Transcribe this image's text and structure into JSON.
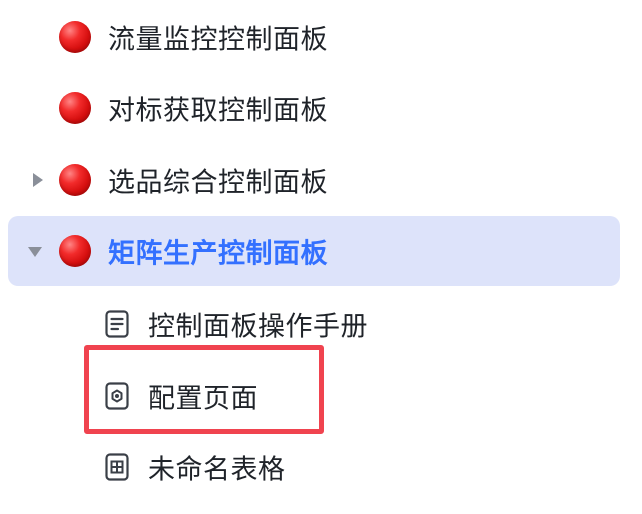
{
  "tree": {
    "items": [
      {
        "label": "流量监控控制面板",
        "icon": "red-circle-icon",
        "expander": "none",
        "selected": false
      },
      {
        "label": "对标获取控制面板",
        "icon": "red-circle-icon",
        "expander": "none",
        "selected": false
      },
      {
        "label": "选品综合控制面板",
        "icon": "red-circle-icon",
        "expander": "collapsed",
        "selected": false
      },
      {
        "label": "矩阵生产控制面板",
        "icon": "red-circle-icon",
        "expander": "expanded",
        "selected": true,
        "children": [
          {
            "label": "控制面板操作手册",
            "icon": "document-icon"
          },
          {
            "label": "配置页面",
            "icon": "config-page-icon",
            "highlighted": true
          },
          {
            "label": "未命名表格",
            "icon": "table-icon"
          }
        ]
      }
    ]
  },
  "colors": {
    "selected_background": "#dde3fa",
    "selected_text": "#3370ff",
    "text": "#1f2329",
    "highlight_border": "#f0434f",
    "expander": "#8a8f99"
  }
}
